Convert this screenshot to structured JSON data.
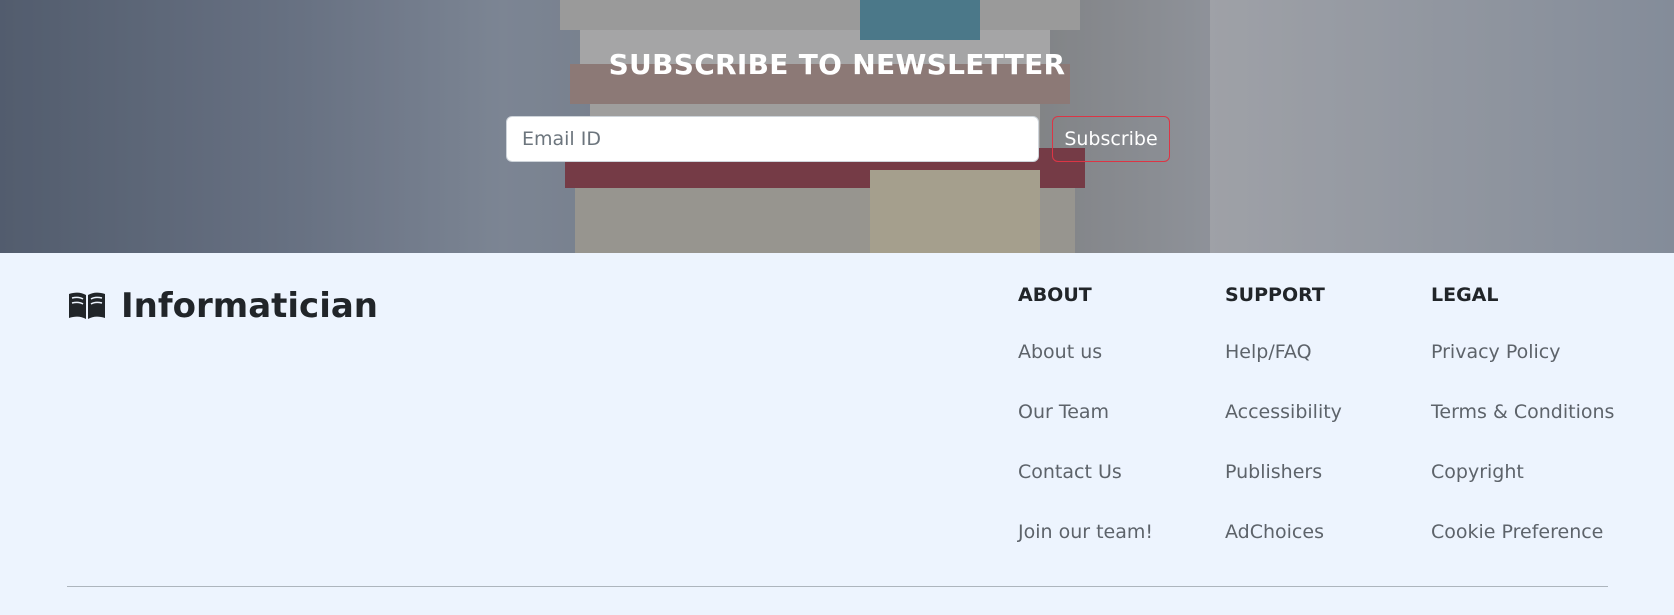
{
  "newsletter": {
    "title": "SUBSCRIBE TO NEWSLETTER",
    "email_placeholder": "Email ID",
    "email_value": "",
    "subscribe_label": "Subscribe"
  },
  "brand": {
    "name": "Informatician",
    "icon": "open-book-icon"
  },
  "footer": {
    "columns": [
      {
        "title": "ABOUT",
        "links": [
          "About us",
          "Our Team",
          "Contact Us",
          "Join our team!"
        ]
      },
      {
        "title": "SUPPORT",
        "links": [
          "Help/FAQ",
          "Accessibility",
          "Publishers",
          "AdChoices"
        ]
      },
      {
        "title": "LEGAL",
        "links": [
          "Privacy Policy",
          "Terms & Conditions",
          "Copyright",
          "Cookie Preference"
        ]
      }
    ]
  },
  "colors": {
    "footer_bg": "#edf4fe",
    "subscribe_border": "#dc3545",
    "link_text": "#5d636a",
    "heading_text": "#212529"
  }
}
